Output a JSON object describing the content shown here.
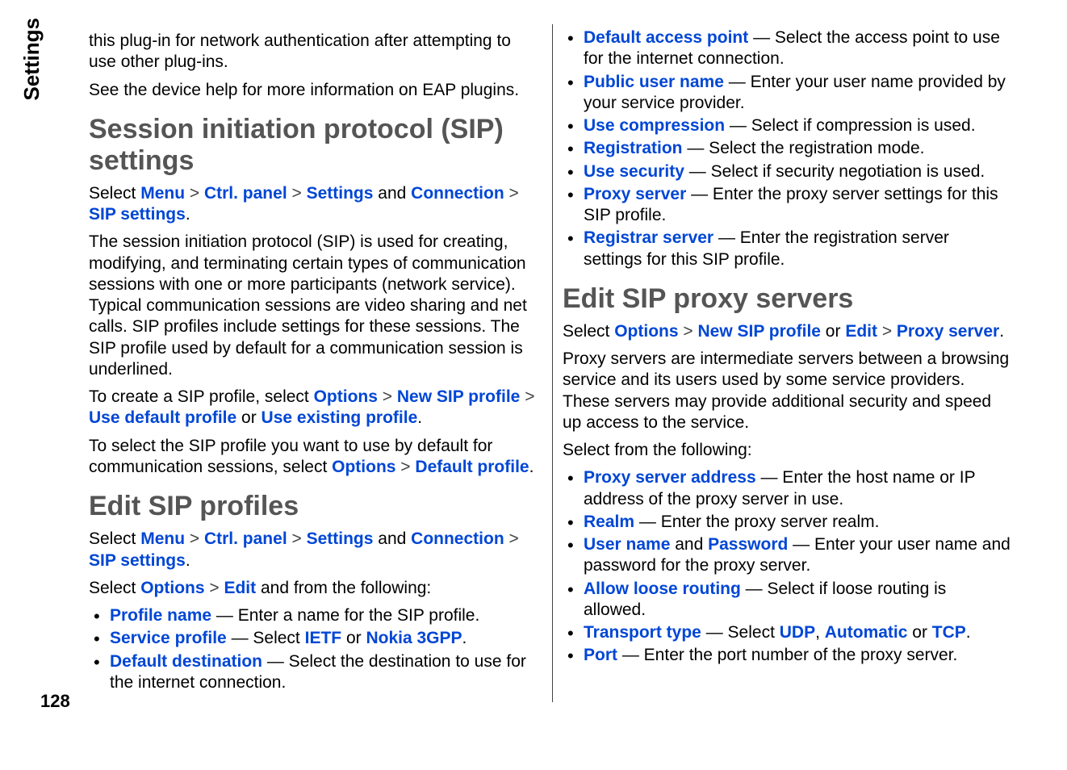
{
  "sideLabel": "Settings",
  "pageNumber": "128",
  "colors": {
    "link": "#0046d5",
    "heading": "#555555"
  },
  "left": {
    "intro1": "this plug-in for network authentication after attempting to use other plug-ins.",
    "intro2": "See the device help for more information on EAP plugins.",
    "h1": "Session initiation protocol (SIP) settings",
    "nav1_parts": {
      "prefix": "Select ",
      "menu": "Menu",
      "gt": " > ",
      "ctrl": "Ctrl. panel",
      "settings": "Settings",
      "and": " and ",
      "conn": "Connection",
      "sip": "SIP settings",
      "period": "."
    },
    "sip_desc": "The session initiation protocol (SIP) is used for creating, modifying, and terminating certain types of communication sessions with one or more participants (network service). Typical communication sessions are video sharing and net calls. SIP profiles include settings for these sessions. The SIP profile used by default for a communication session is underlined.",
    "create_parts": {
      "prefix": "To create a SIP profile, select ",
      "options": "Options",
      "gt": " > ",
      "newsip": "New SIP profile",
      "usedef": "Use default profile",
      "or": " or ",
      "useex": "Use existing profile",
      "period": "."
    },
    "select_parts": {
      "prefix": "To select the SIP profile you want to use by default for communication sessions, select ",
      "options": "Options",
      "gt": " > ",
      "def": "Default profile",
      "period": "."
    },
    "h2": "Edit SIP profiles",
    "edit_nav": {
      "prefix": "Select ",
      "options": "Options",
      "gt": " > ",
      "edit": "Edit",
      "suffix": " and from the following:"
    },
    "items": [
      {
        "title": "Profile name",
        "desc": " — Enter a name for the SIP profile."
      },
      {
        "title": "Service profile",
        "desc": " — Select ",
        "opt1": "IETF",
        "or": " or ",
        "opt2": "Nokia 3GPP",
        "period": "."
      },
      {
        "title": "Default destination",
        "desc": " — Select the destination to use for the internet connection."
      }
    ]
  },
  "right": {
    "items_top": [
      {
        "title": "Default access point",
        "desc": " — Select the access point to use for the internet connection."
      },
      {
        "title": "Public user name",
        "desc": " — Enter your user name provided by your service provider."
      },
      {
        "title": "Use compression",
        "desc": " — Select if compression is used."
      },
      {
        "title": "Registration",
        "desc": " — Select the registration mode."
      },
      {
        "title": "Use security",
        "desc": " — Select if security negotiation is used."
      },
      {
        "title": "Proxy server",
        "desc": " — Enter the proxy server settings for this SIP profile."
      },
      {
        "title": "Registrar server",
        "desc": " — Enter the registration server settings for this SIP profile."
      }
    ],
    "h1": "Edit SIP proxy servers",
    "nav_parts": {
      "prefix": "Select ",
      "options": "Options",
      "gt": " > ",
      "newsip": "New SIP profile",
      "or": " or ",
      "edit": "Edit",
      "proxy": "Proxy server",
      "period": "."
    },
    "proxy_desc": "Proxy servers are intermediate servers between a browsing service and its users used by some service providers. These servers may provide additional security and speed up access to the service.",
    "select_from": "Select from the following:",
    "items_bottom": [
      {
        "title": "Proxy server address",
        "desc": " — Enter the host name or IP address of the proxy server in use."
      },
      {
        "title": "Realm",
        "desc": " — Enter the proxy server realm."
      },
      {
        "title": "User name",
        "and": " and ",
        "title2": "Password",
        "desc": " — Enter your user name and password for the proxy server."
      },
      {
        "title": "Allow loose routing",
        "desc": " — Select if loose routing is allowed."
      },
      {
        "title": "Transport type",
        "desc": " — Select ",
        "opt1": "UDP",
        "comma": ", ",
        "opt2": "Automatic",
        "or": " or ",
        "opt3": "TCP",
        "period": "."
      },
      {
        "title": "Port",
        "desc": " — Enter the port number of the proxy server."
      }
    ]
  }
}
